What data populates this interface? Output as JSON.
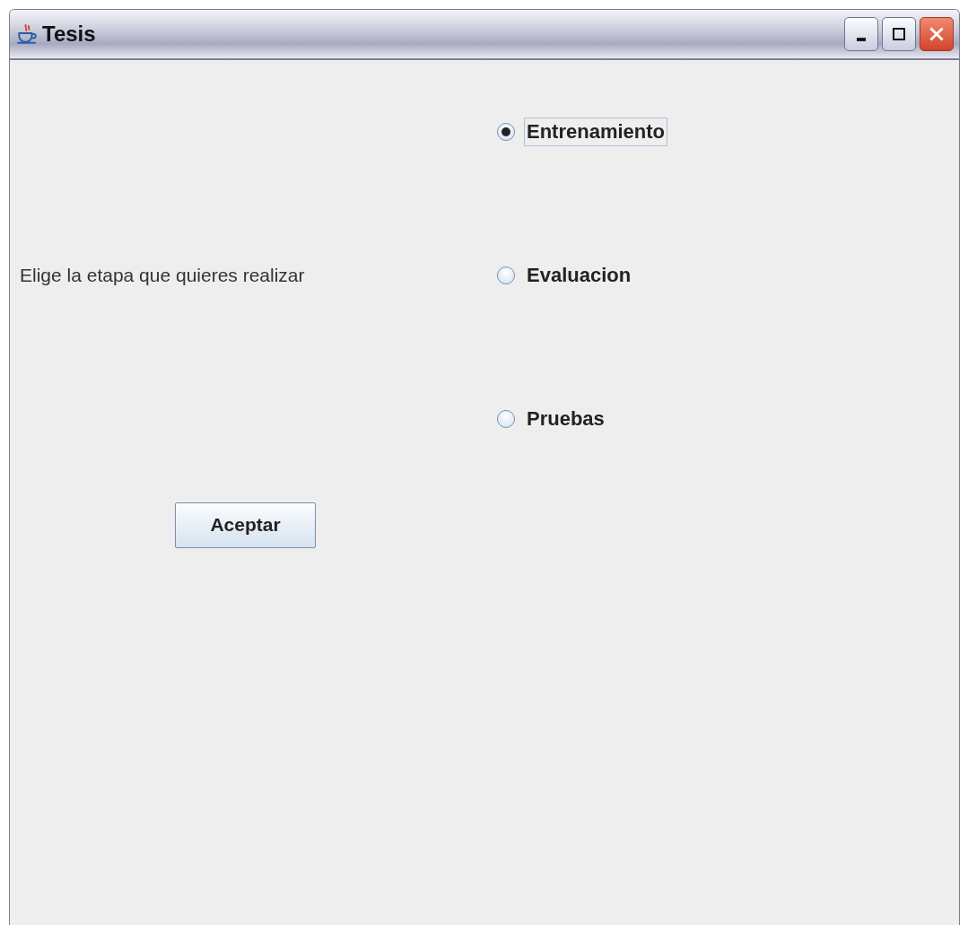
{
  "window": {
    "title": "Tesis"
  },
  "prompt": "Elige la etapa que quieres realizar",
  "options": [
    {
      "label": "Entrenamiento",
      "selected": true,
      "focused": true
    },
    {
      "label": "Evaluacion",
      "selected": false,
      "focused": false
    },
    {
      "label": "Pruebas",
      "selected": false,
      "focused": false
    }
  ],
  "buttons": [
    "Aceptar"
  ]
}
